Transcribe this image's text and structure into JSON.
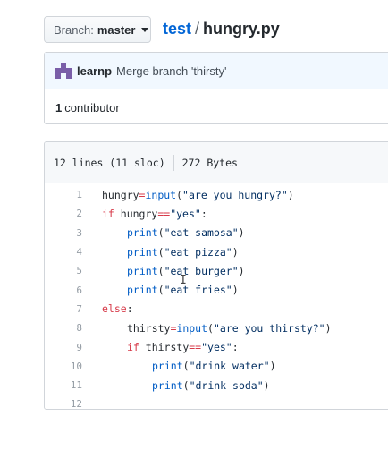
{
  "header": {
    "branch_label": "Branch:",
    "branch_value": "master",
    "repo": "test",
    "separator": "/",
    "file": "hungry.py"
  },
  "commit": {
    "author": "learnp",
    "message": "Merge branch 'thirsty'"
  },
  "contributors": {
    "count": "1",
    "label": "contributor"
  },
  "file_info": {
    "lines": "12 lines (11 sloc)",
    "size": "272 Bytes"
  },
  "code": {
    "lines": [
      {
        "n": "1",
        "indent": 0,
        "tokens": [
          [
            "v",
            "hungry"
          ],
          [
            "op",
            "="
          ],
          [
            "fn",
            "input"
          ],
          [
            "p",
            "("
          ],
          [
            "str",
            "\"are you hungry?\""
          ],
          [
            "p",
            ")"
          ]
        ]
      },
      {
        "n": "2",
        "indent": 0,
        "tokens": [
          [
            "kw",
            "if"
          ],
          [
            "v",
            " hungry"
          ],
          [
            "op",
            "=="
          ],
          [
            "str",
            "\"yes\""
          ],
          [
            "p",
            ":"
          ]
        ]
      },
      {
        "n": "3",
        "indent": 1,
        "tokens": [
          [
            "fn",
            "print"
          ],
          [
            "p",
            "("
          ],
          [
            "str",
            "\"eat samosa\""
          ],
          [
            "p",
            ")"
          ]
        ]
      },
      {
        "n": "4",
        "indent": 1,
        "tokens": [
          [
            "fn",
            "print"
          ],
          [
            "p",
            "("
          ],
          [
            "str",
            "\"eat pizza\""
          ],
          [
            "p",
            ")"
          ]
        ]
      },
      {
        "n": "5",
        "indent": 1,
        "tokens": [
          [
            "fn",
            "print"
          ],
          [
            "p",
            "("
          ],
          [
            "str",
            "\"eat burger\""
          ],
          [
            "p",
            ")"
          ]
        ]
      },
      {
        "n": "6",
        "indent": 1,
        "tokens": [
          [
            "fn",
            "print"
          ],
          [
            "p",
            "("
          ],
          [
            "str",
            "\"eat fries\""
          ],
          [
            "p",
            ")"
          ]
        ]
      },
      {
        "n": "7",
        "indent": 0,
        "tokens": [
          [
            "kw",
            "else"
          ],
          [
            "p",
            ":"
          ]
        ]
      },
      {
        "n": "8",
        "indent": 1,
        "tokens": [
          [
            "v",
            "thirsty"
          ],
          [
            "op",
            "="
          ],
          [
            "fn",
            "input"
          ],
          [
            "p",
            "("
          ],
          [
            "str",
            "\"are you thirsty?\""
          ],
          [
            "p",
            ")"
          ]
        ]
      },
      {
        "n": "9",
        "indent": 1,
        "tokens": [
          [
            "kw",
            "if"
          ],
          [
            "v",
            " thirsty"
          ],
          [
            "op",
            "=="
          ],
          [
            "str",
            "\"yes\""
          ],
          [
            "p",
            ":"
          ]
        ]
      },
      {
        "n": "10",
        "indent": 2,
        "tokens": [
          [
            "fn",
            "print"
          ],
          [
            "p",
            "("
          ],
          [
            "str",
            "\"drink water\""
          ],
          [
            "p",
            ")"
          ]
        ]
      },
      {
        "n": "11",
        "indent": 2,
        "tokens": [
          [
            "fn",
            "print"
          ],
          [
            "p",
            "("
          ],
          [
            "str",
            "\"drink soda\""
          ],
          [
            "p",
            ")"
          ]
        ]
      },
      {
        "n": "12",
        "indent": 0,
        "tokens": []
      }
    ]
  },
  "icons": {
    "avatar": "identicon-avatar",
    "caret": "caret-down-icon",
    "cursor": "text-cursor-icon"
  }
}
